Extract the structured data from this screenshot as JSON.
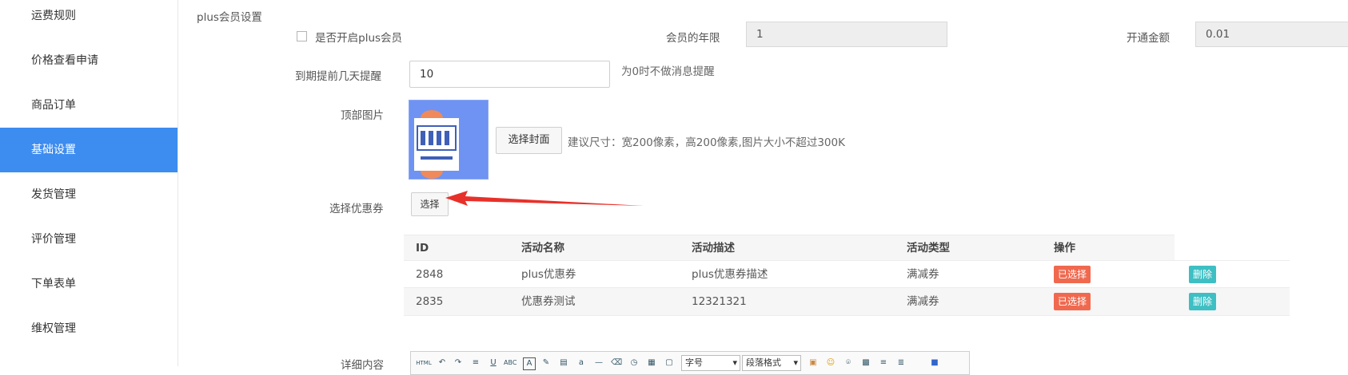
{
  "sidebar": {
    "items": [
      {
        "label": "运费规则",
        "active": false
      },
      {
        "label": "价格查看申请",
        "active": false
      },
      {
        "label": "商品订单",
        "active": false
      },
      {
        "label": "基础设置",
        "active": true
      },
      {
        "label": "发货管理",
        "active": false
      },
      {
        "label": "评价管理",
        "active": false
      },
      {
        "label": "下单表单",
        "active": false
      },
      {
        "label": "维权管理",
        "active": false
      }
    ]
  },
  "form": {
    "section_title": "plus会员设置",
    "enable_plus_label": "是否开启plus会员",
    "enable_plus_checked": false,
    "years_label": "会员的年限",
    "years_value": "1",
    "fee_label": "开通金额",
    "fee_value": "0.01",
    "remind_label": "到期提前几天提醒",
    "remind_value": "10",
    "remind_hint": "为0时不做消息提醒",
    "top_image_label": "顶部图片",
    "choose_cover_button": "选择封面",
    "cover_hint": "建议尺寸：宽200像素，高200像素,图片大小不超过300K",
    "coupon_label": "选择优惠券",
    "coupon_button": "选择",
    "detail_label": "详细内容"
  },
  "coupon_table": {
    "columns": [
      "ID",
      "活动名称",
      "活动描述",
      "活动类型",
      "操作"
    ],
    "rows": [
      {
        "id": "2848",
        "name": "plus优惠券",
        "desc": "plus优惠券描述",
        "type": "满减券",
        "selected_label": "已选择",
        "delete_label": "删除"
      },
      {
        "id": "2835",
        "name": "优惠券测试",
        "desc": "12321321",
        "type": "满减券",
        "selected_label": "已选择",
        "delete_label": "删除"
      }
    ]
  },
  "editor": {
    "font_size_select": "字号",
    "paragraph_select": "段落格式"
  },
  "colors": {
    "accent": "#3d8cf0",
    "tag_selected": "#f0694f",
    "tag_delete": "#3ebfc3",
    "annotation_arrow": "#e8302a"
  }
}
